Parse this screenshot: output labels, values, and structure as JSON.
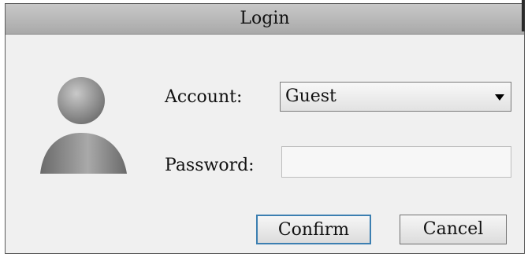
{
  "dialog": {
    "title": "Login",
    "account_label": "Account:",
    "password_label": "Password:",
    "account_value": "Guest",
    "password_value": "",
    "confirm_label": "Confirm",
    "cancel_label": "Cancel",
    "icons": {
      "avatar": "user-avatar-icon",
      "dropdown": "chevron-down-icon"
    },
    "colors": {
      "title_bar": "#b5b5b5",
      "body": "#f0f0f0",
      "focus_border": "#3c7fb1"
    }
  }
}
